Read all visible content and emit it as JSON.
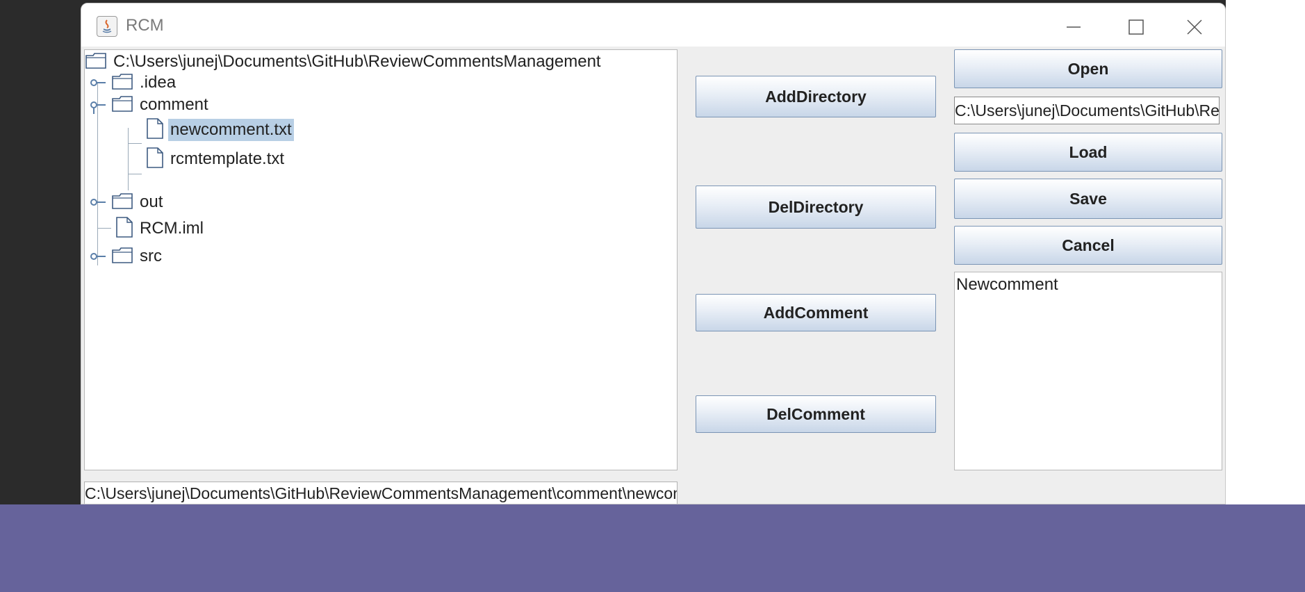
{
  "window": {
    "title": "RCM"
  },
  "tree": {
    "root": "C:\\Users\\junej\\Documents\\GitHub\\ReviewCommentsManagement",
    "nodes": [
      {
        "label": ".idea",
        "type": "folder"
      },
      {
        "label": "comment",
        "type": "folder",
        "expanded": true
      },
      {
        "label": "newcomment.txt",
        "type": "file",
        "selected": true
      },
      {
        "label": "rcmtemplate.txt",
        "type": "file"
      },
      {
        "label": "out",
        "type": "folder"
      },
      {
        "label": "RCM.iml",
        "type": "file"
      },
      {
        "label": "src",
        "type": "folder"
      }
    ]
  },
  "path_bar": {
    "value": "C:\\Users\\junej\\Documents\\GitHub\\ReviewCommentsManagement\\comment\\newcomment.txt"
  },
  "middle_buttons": {
    "add_directory": "AddDirectory",
    "del_directory": "DelDirectory",
    "add_comment": "AddComment",
    "del_comment": "DelComment"
  },
  "right_panel": {
    "open": "Open",
    "path_value": "C:\\Users\\junej\\Documents\\GitHub\\ReviewCommentsManagement\\comment\\newcomment.txt",
    "load": "Load",
    "save": "Save",
    "cancel": "Cancel",
    "comment_text": "Newcomment"
  },
  "colors": {
    "selection": "#b8cfe5",
    "taskbar": "#66639b",
    "button_border": "#7a94b4"
  }
}
